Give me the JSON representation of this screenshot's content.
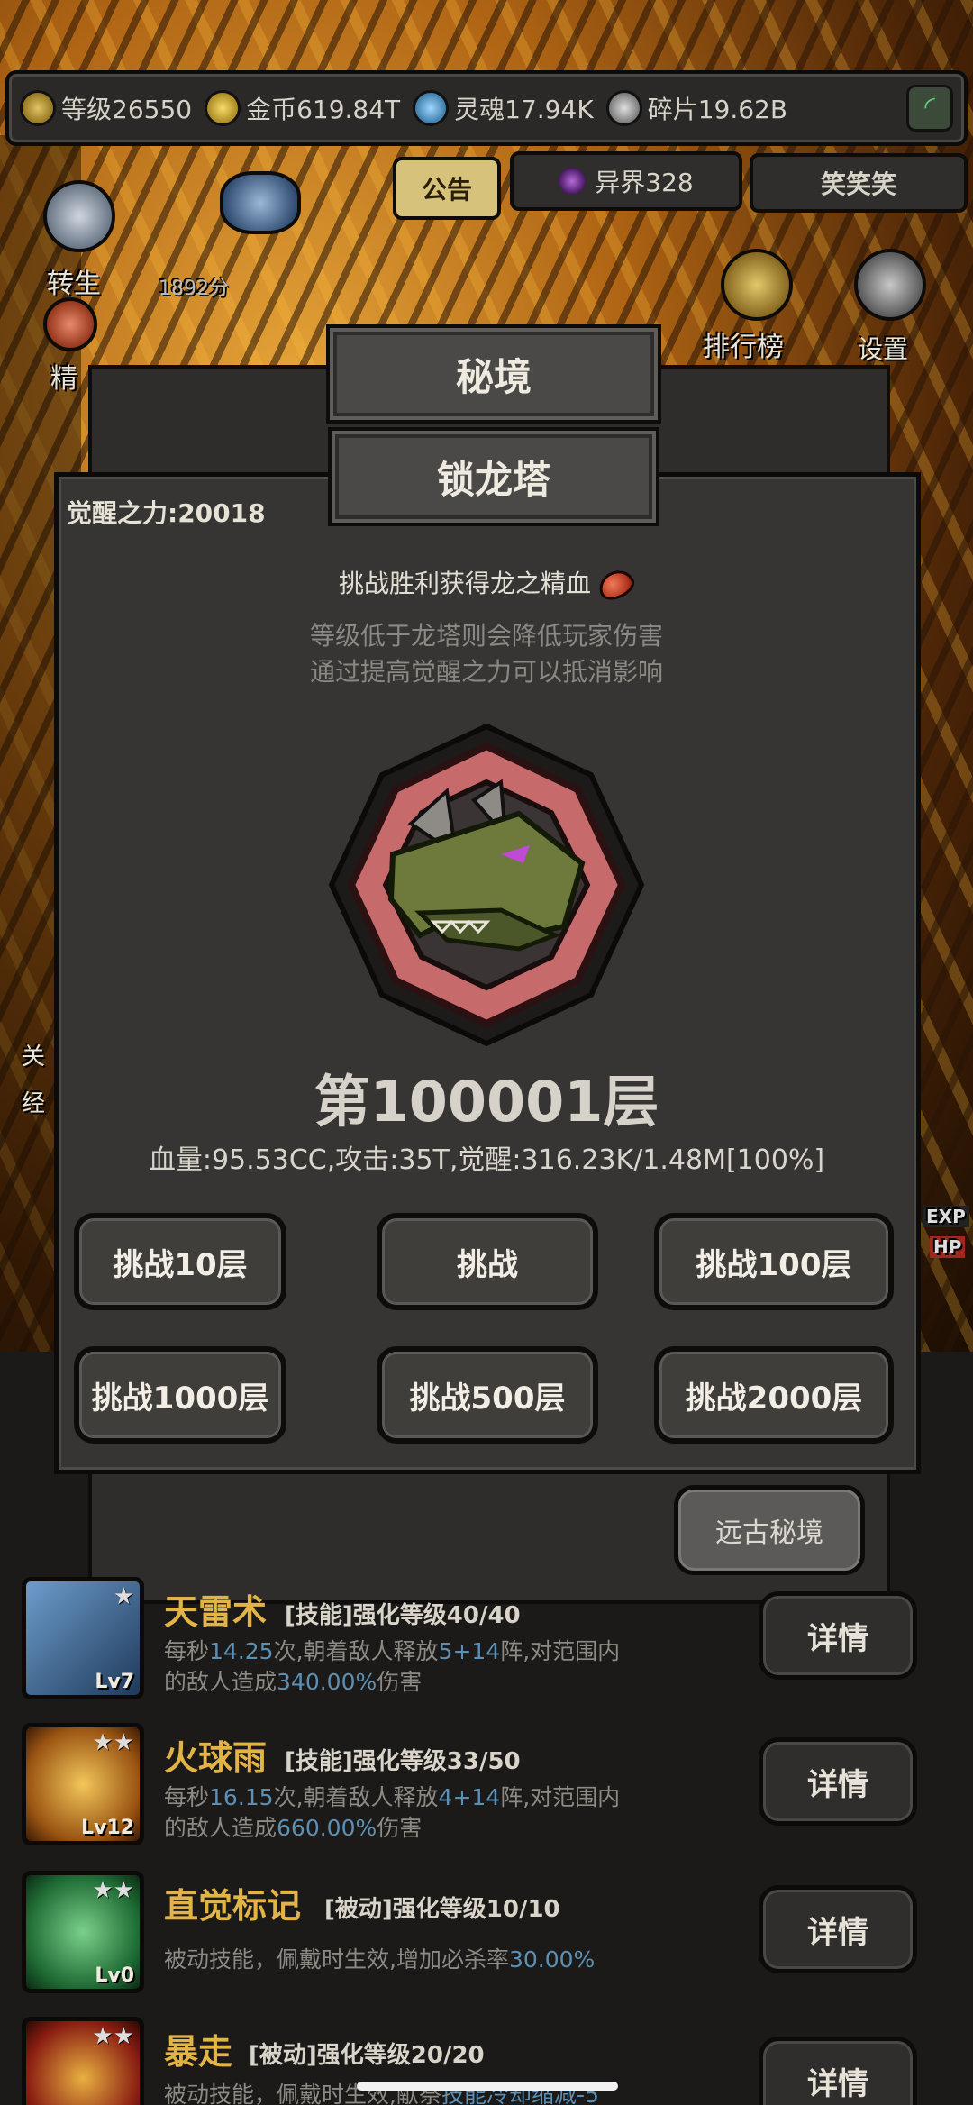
{
  "topbar": {
    "level": "等级26550",
    "gold": "金币619.84T",
    "soul": "灵魂17.94K",
    "shard": "碎片19.62B"
  },
  "tabs": {
    "notice": "公告",
    "otherworld": "异界328",
    "xiaoxiao": "笑笑笑"
  },
  "scene": {
    "rebirth": "转生",
    "rebirth_score": "1892分",
    "refine": "精",
    "ranking": "排行榜",
    "settings": "设置",
    "left_1": "关",
    "left_2": "经",
    "exp_tag": "EXP",
    "hp_tag": "HP"
  },
  "modal": {
    "secret_title": "秘境",
    "tower_title": "锁龙塔",
    "awaken_power": "觉醒之力:20018",
    "reward": "挑战胜利获得龙之精血",
    "note1": "等级低于龙塔则会降低玩家伤害",
    "note2": "通过提高觉醒之力可以抵消影响",
    "floor": "第100001层",
    "stats": "血量:95.53CC,攻击:35T,觉醒:316.23K/1.48M[100%]",
    "buttons": {
      "ten": "挑战10层",
      "one": "挑战",
      "hundred": "挑战100层",
      "thousand": "挑战1000层",
      "five_hundred": "挑战500层",
      "two_thousand": "挑战2000层"
    },
    "ancient": "远古秘境"
  },
  "skills": [
    {
      "name": "天雷术",
      "tag": "[技能]强化等级40/40",
      "lv": "Lv7",
      "desc1_a": "每秒",
      "desc1_b": "14.25",
      "desc1_c": "次,朝着敌人释放",
      "desc1_d": "5+14",
      "desc1_e": "阵,对范围内",
      "desc2_a": "的敌人造成",
      "desc2_b": "340.00%",
      "desc2_c": "伤害",
      "detail": "详情"
    },
    {
      "name": "火球雨",
      "tag": "[技能]强化等级33/50",
      "lv": "Lv12",
      "desc1_a": "每秒",
      "desc1_b": "16.15",
      "desc1_c": "次,朝着敌人释放",
      "desc1_d": "4+14",
      "desc1_e": "阵,对范围内",
      "desc2_a": "的敌人造成",
      "desc2_b": "660.00%",
      "desc2_c": "伤害",
      "detail": "详情"
    },
    {
      "name": "直觉标记",
      "tag": "[被动]强化等级10/10",
      "lv": "Lv0",
      "desc1_a": "被动技能，佩戴时生效,增加必杀率",
      "desc1_b": "30.00%",
      "detail": "详情"
    },
    {
      "name": "暴走",
      "tag": "[被动]强化等级20/20",
      "desc1_a": "被动技能，佩戴时生效,献祭",
      "desc1_b": "技能冷却缩减-5",
      "detail": "详情"
    }
  ],
  "colors": {
    "accent_gold": "#e2b346",
    "highlight_blue": "#5c8fb4",
    "notice_bg": "#d6c27a"
  }
}
